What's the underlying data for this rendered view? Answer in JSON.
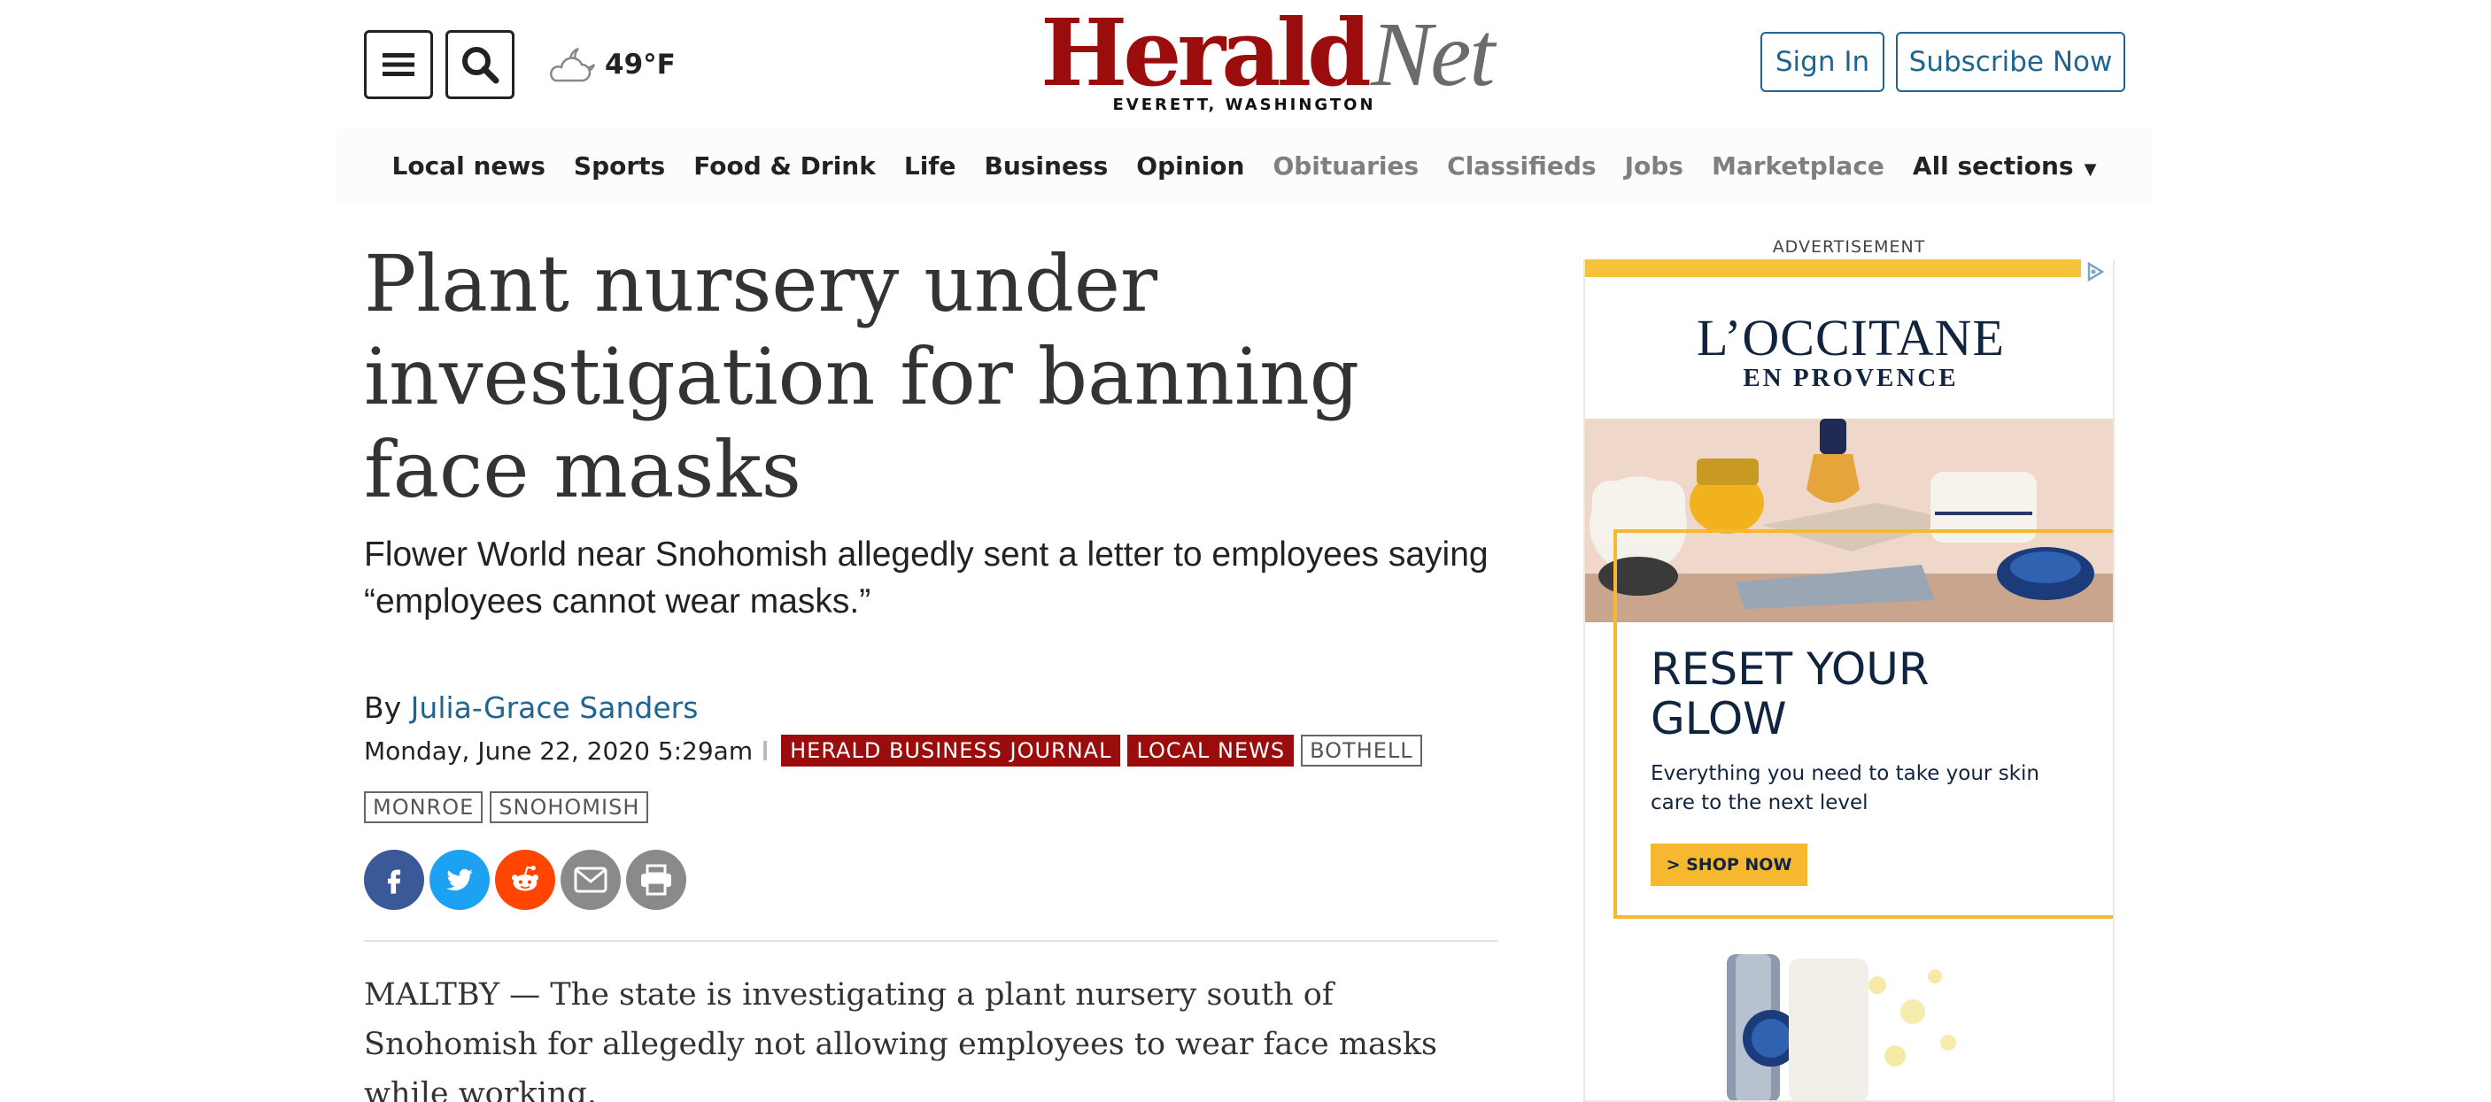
{
  "header": {
    "weather_temp": "49°F",
    "logo_primary": "Herald",
    "logo_secondary": "Net",
    "logo_tagline": "EVERETT, WASHINGTON",
    "signin_label": "Sign In",
    "subscribe_label": "Subscribe Now",
    "icons": {
      "menu": "hamburger-icon",
      "search": "search-icon",
      "weather": "partly-cloudy-night-icon"
    }
  },
  "nav": {
    "items": [
      {
        "label": "Local news",
        "style": "dark"
      },
      {
        "label": "Sports",
        "style": "dark"
      },
      {
        "label": "Food & Drink",
        "style": "dark"
      },
      {
        "label": "Life",
        "style": "dark"
      },
      {
        "label": "Business",
        "style": "dark"
      },
      {
        "label": "Opinion",
        "style": "dark"
      },
      {
        "label": "Obituaries",
        "style": "gray"
      },
      {
        "label": "Classifieds",
        "style": "gray"
      },
      {
        "label": "Jobs",
        "style": "gray"
      },
      {
        "label": "Marketplace",
        "style": "gray"
      },
      {
        "label": "All sections",
        "style": "dark"
      }
    ]
  },
  "article": {
    "headline": "Plant nursery under investigation for banning face masks",
    "subhead": "Flower World near Snohomish allegedly sent a letter to employees saying “employees cannot wear masks.”",
    "byline_prefix": "By",
    "author": "Julia-Grace Sanders",
    "date": "Monday, June 22, 2020 5:29am",
    "tags": [
      {
        "label": "HERALD BUSINESS JOURNAL",
        "style": "red"
      },
      {
        "label": "LOCAL NEWS",
        "style": "red"
      },
      {
        "label": "BOTHELL",
        "style": "outline"
      },
      {
        "label": "MONROE",
        "style": "outline"
      },
      {
        "label": "SNOHOMISH",
        "style": "outline"
      }
    ],
    "share_icons": [
      "facebook-icon",
      "twitter-icon",
      "reddit-icon",
      "email-icon",
      "print-icon"
    ],
    "body_first_paragraph": "MALTBY — The state is investigating a plant nursery south of Snohomish for allegedly not allowing employees to wear face masks while working."
  },
  "ad": {
    "label": "ADVERTISEMENT",
    "brand_main": "L’OCCITANE",
    "brand_sub": "EN PROVENCE",
    "headline": "RESET YOUR GLOW",
    "copy": "Everything you need to take your skin care to the next level",
    "cta": "> SHOP NOW"
  },
  "colors": {
    "brand_red": "#9b0d0d",
    "link_blue": "#1e6591",
    "ad_gold": "#f5b82e",
    "ad_navy": "#10243f"
  }
}
